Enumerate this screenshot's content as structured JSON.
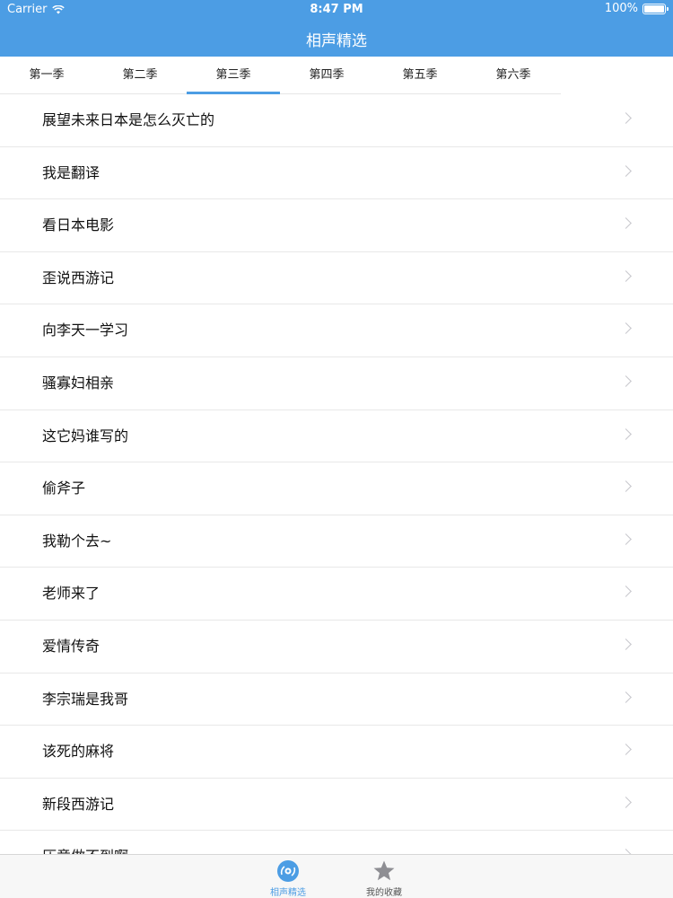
{
  "status_bar": {
    "carrier": "Carrier",
    "time": "8:47 PM",
    "battery": "100%"
  },
  "nav": {
    "title": "相声精选"
  },
  "tabs": [
    {
      "label": "第一季"
    },
    {
      "label": "第二季"
    },
    {
      "label": "第三季",
      "selected": true
    },
    {
      "label": "第四季"
    },
    {
      "label": "第五季"
    },
    {
      "label": "第六季"
    }
  ],
  "list": {
    "items": [
      {
        "label": "展望未来日本是怎么灭亡的"
      },
      {
        "label": "我是翻译"
      },
      {
        "label": "看日本电影"
      },
      {
        "label": "歪说西游记"
      },
      {
        "label": "向李天一学习"
      },
      {
        "label": "骚寡妇相亲"
      },
      {
        "label": "这它妈谁写的"
      },
      {
        "label": "偷斧子"
      },
      {
        "label": "我勒个去~"
      },
      {
        "label": "老师来了"
      },
      {
        "label": "爱情传奇"
      },
      {
        "label": "李宗瑞是我哥"
      },
      {
        "label": "该死的麻将"
      },
      {
        "label": "新段西游记"
      },
      {
        "label": "压意做不到啊"
      }
    ]
  },
  "tabbar": {
    "items": [
      {
        "label": "相声精选",
        "icon": "disc-icon",
        "active": true
      },
      {
        "label": "我的收藏",
        "icon": "star-icon",
        "active": false
      }
    ]
  },
  "colors": {
    "accent": "#4c9de4",
    "inactive": "#8e8e93"
  }
}
